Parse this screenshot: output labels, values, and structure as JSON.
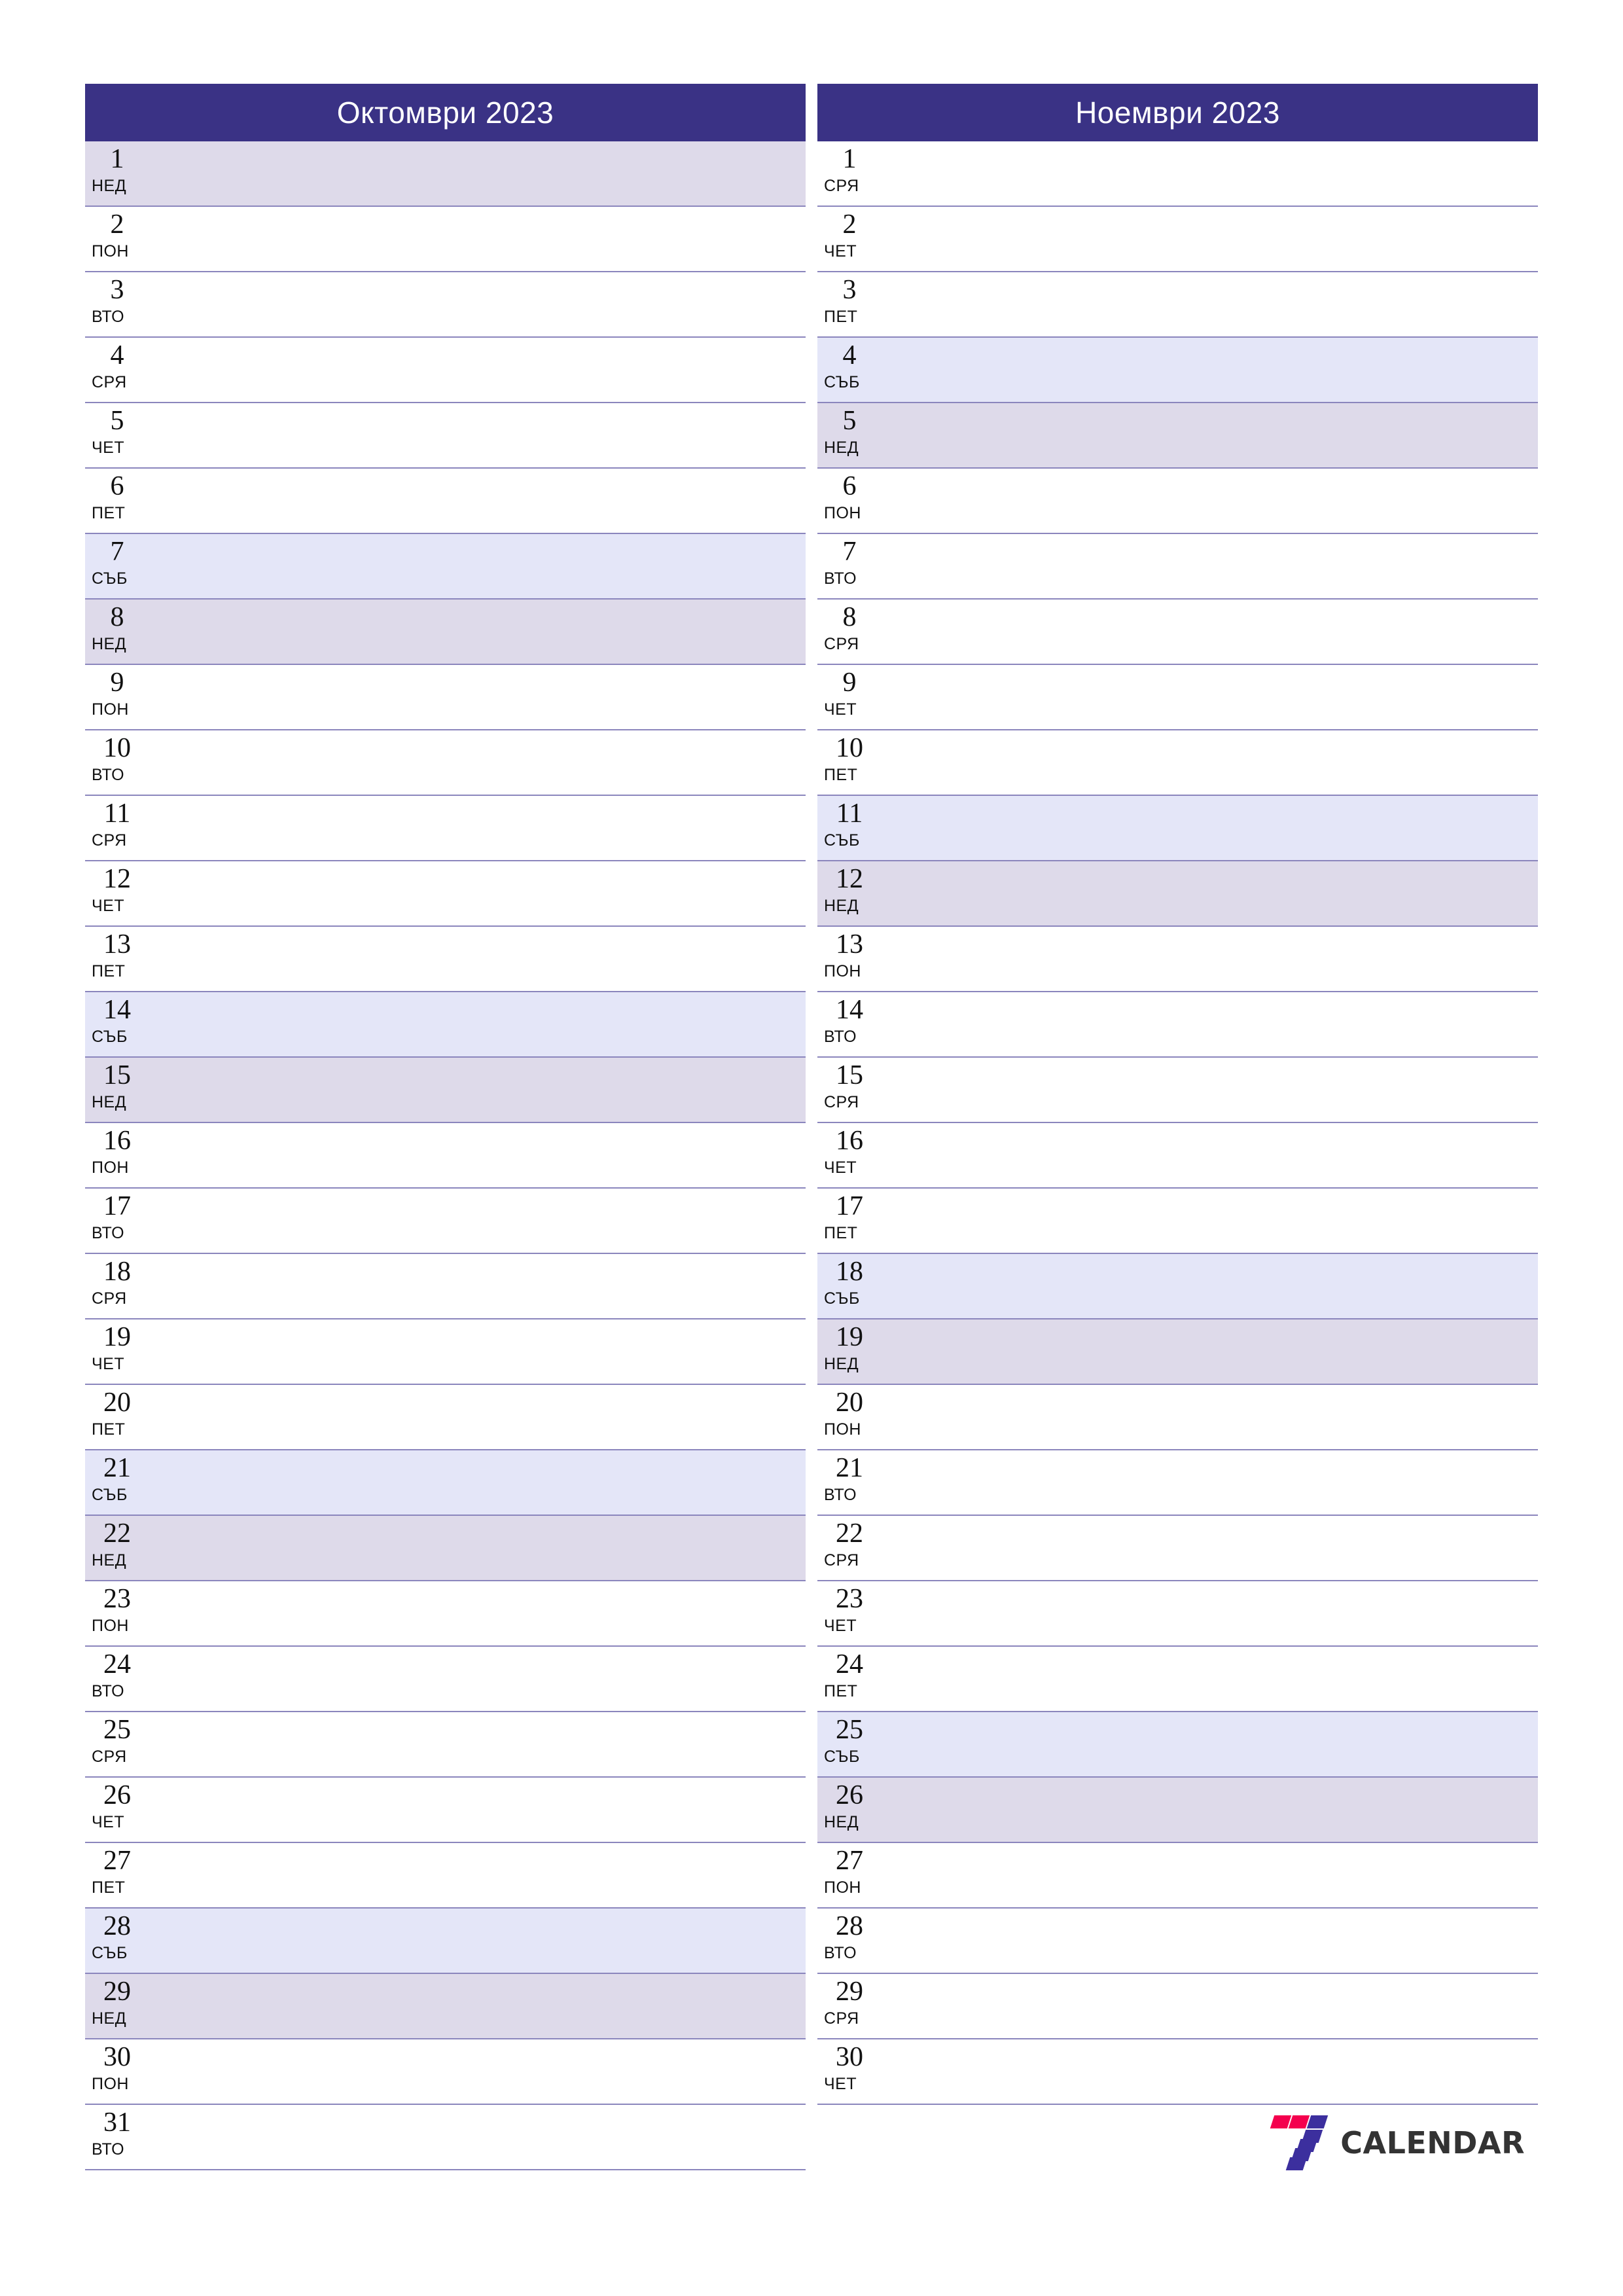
{
  "page": {
    "background": "#ffffff",
    "accent_header": "#3a3285",
    "saturday_bg": "#e4e6f8",
    "sunday_bg": "#dedaea",
    "rule_color": "#8b86bd"
  },
  "months": [
    {
      "title": "Октомври 2023",
      "name": "october",
      "days": [
        {
          "num": "1",
          "abbr": "НЕД",
          "type": "sun"
        },
        {
          "num": "2",
          "abbr": "ПОН",
          "type": "weekday"
        },
        {
          "num": "3",
          "abbr": "ВТО",
          "type": "weekday"
        },
        {
          "num": "4",
          "abbr": "СРЯ",
          "type": "weekday"
        },
        {
          "num": "5",
          "abbr": "ЧЕТ",
          "type": "weekday"
        },
        {
          "num": "6",
          "abbr": "ПЕТ",
          "type": "weekday"
        },
        {
          "num": "7",
          "abbr": "СЪБ",
          "type": "sat"
        },
        {
          "num": "8",
          "abbr": "НЕД",
          "type": "sun"
        },
        {
          "num": "9",
          "abbr": "ПОН",
          "type": "weekday"
        },
        {
          "num": "10",
          "abbr": "ВТО",
          "type": "weekday"
        },
        {
          "num": "11",
          "abbr": "СРЯ",
          "type": "weekday"
        },
        {
          "num": "12",
          "abbr": "ЧЕТ",
          "type": "weekday"
        },
        {
          "num": "13",
          "abbr": "ПЕТ",
          "type": "weekday"
        },
        {
          "num": "14",
          "abbr": "СЪБ",
          "type": "sat"
        },
        {
          "num": "15",
          "abbr": "НЕД",
          "type": "sun"
        },
        {
          "num": "16",
          "abbr": "ПОН",
          "type": "weekday"
        },
        {
          "num": "17",
          "abbr": "ВТО",
          "type": "weekday"
        },
        {
          "num": "18",
          "abbr": "СРЯ",
          "type": "weekday"
        },
        {
          "num": "19",
          "abbr": "ЧЕТ",
          "type": "weekday"
        },
        {
          "num": "20",
          "abbr": "ПЕТ",
          "type": "weekday"
        },
        {
          "num": "21",
          "abbr": "СЪБ",
          "type": "sat"
        },
        {
          "num": "22",
          "abbr": "НЕД",
          "type": "sun"
        },
        {
          "num": "23",
          "abbr": "ПОН",
          "type": "weekday"
        },
        {
          "num": "24",
          "abbr": "ВТО",
          "type": "weekday"
        },
        {
          "num": "25",
          "abbr": "СРЯ",
          "type": "weekday"
        },
        {
          "num": "26",
          "abbr": "ЧЕТ",
          "type": "weekday"
        },
        {
          "num": "27",
          "abbr": "ПЕТ",
          "type": "weekday"
        },
        {
          "num": "28",
          "abbr": "СЪБ",
          "type": "sat"
        },
        {
          "num": "29",
          "abbr": "НЕД",
          "type": "sun"
        },
        {
          "num": "30",
          "abbr": "ПОН",
          "type": "weekday"
        },
        {
          "num": "31",
          "abbr": "ВТО",
          "type": "weekday"
        }
      ]
    },
    {
      "title": "Ноември 2023",
      "name": "november",
      "days": [
        {
          "num": "1",
          "abbr": "СРЯ",
          "type": "weekday"
        },
        {
          "num": "2",
          "abbr": "ЧЕТ",
          "type": "weekday"
        },
        {
          "num": "3",
          "abbr": "ПЕТ",
          "type": "weekday"
        },
        {
          "num": "4",
          "abbr": "СЪБ",
          "type": "sat"
        },
        {
          "num": "5",
          "abbr": "НЕД",
          "type": "sun"
        },
        {
          "num": "6",
          "abbr": "ПОН",
          "type": "weekday"
        },
        {
          "num": "7",
          "abbr": "ВТО",
          "type": "weekday"
        },
        {
          "num": "8",
          "abbr": "СРЯ",
          "type": "weekday"
        },
        {
          "num": "9",
          "abbr": "ЧЕТ",
          "type": "weekday"
        },
        {
          "num": "10",
          "abbr": "ПЕТ",
          "type": "weekday"
        },
        {
          "num": "11",
          "abbr": "СЪБ",
          "type": "sat"
        },
        {
          "num": "12",
          "abbr": "НЕД",
          "type": "sun"
        },
        {
          "num": "13",
          "abbr": "ПОН",
          "type": "weekday"
        },
        {
          "num": "14",
          "abbr": "ВТО",
          "type": "weekday"
        },
        {
          "num": "15",
          "abbr": "СРЯ",
          "type": "weekday"
        },
        {
          "num": "16",
          "abbr": "ЧЕТ",
          "type": "weekday"
        },
        {
          "num": "17",
          "abbr": "ПЕТ",
          "type": "weekday"
        },
        {
          "num": "18",
          "abbr": "СЪБ",
          "type": "sat"
        },
        {
          "num": "19",
          "abbr": "НЕД",
          "type": "sun"
        },
        {
          "num": "20",
          "abbr": "ПОН",
          "type": "weekday"
        },
        {
          "num": "21",
          "abbr": "ВТО",
          "type": "weekday"
        },
        {
          "num": "22",
          "abbr": "СРЯ",
          "type": "weekday"
        },
        {
          "num": "23",
          "abbr": "ЧЕТ",
          "type": "weekday"
        },
        {
          "num": "24",
          "abbr": "ПЕТ",
          "type": "weekday"
        },
        {
          "num": "25",
          "abbr": "СЪБ",
          "type": "sat"
        },
        {
          "num": "26",
          "abbr": "НЕД",
          "type": "sun"
        },
        {
          "num": "27",
          "abbr": "ПОН",
          "type": "weekday"
        },
        {
          "num": "28",
          "abbr": "ВТО",
          "type": "weekday"
        },
        {
          "num": "29",
          "abbr": "СРЯ",
          "type": "weekday"
        },
        {
          "num": "30",
          "abbr": "ЧЕТ",
          "type": "weekday"
        }
      ]
    }
  ],
  "brand": {
    "word": "CALENDAR",
    "mark_colors": {
      "red": "#f4004e",
      "indigo": "#3c2f9e"
    },
    "word_color": "#333333"
  }
}
